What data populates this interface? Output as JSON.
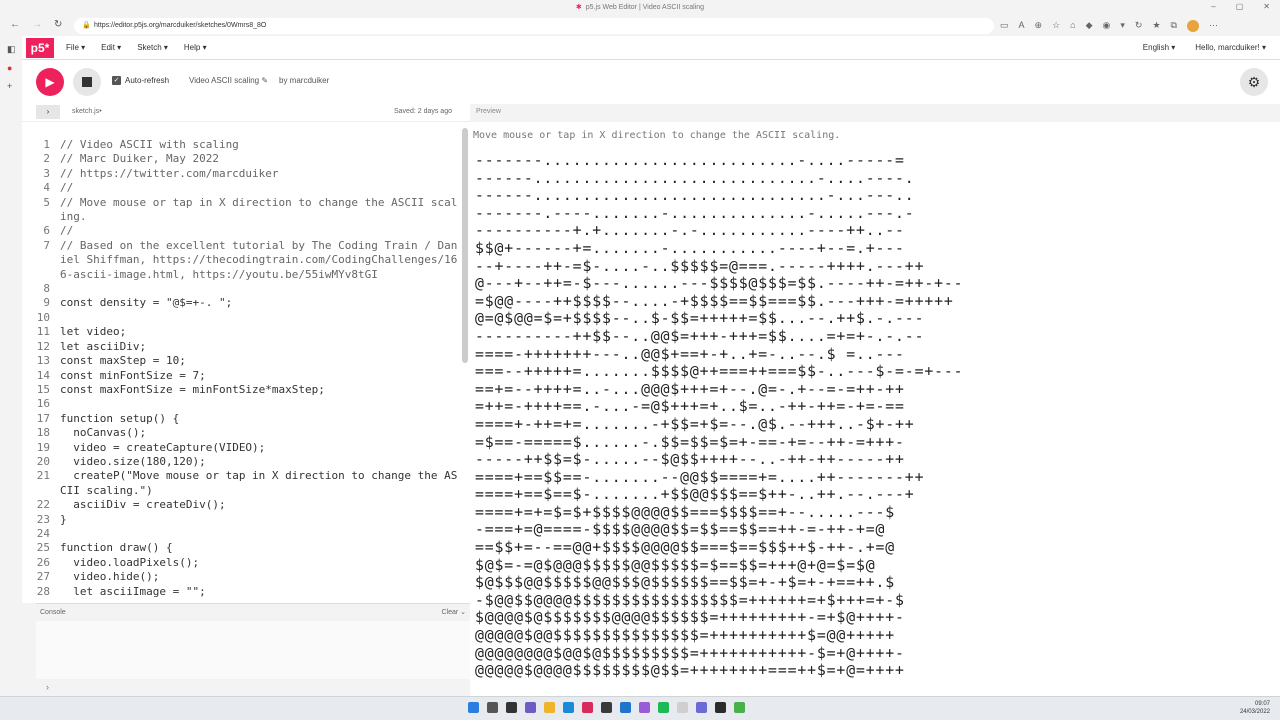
{
  "browser": {
    "window_title": "p5.js Web Editor | Video ASCII scaling",
    "url": "https://editor.p5js.org/marcduiker/sketches/0Wmrs8_8O"
  },
  "p5": {
    "logo": "p5*",
    "menu": [
      "File",
      "Edit",
      "Sketch",
      "Help"
    ],
    "language": "English",
    "greeting": "Hello, marcduiker!",
    "auto_refresh": "Auto-refresh",
    "sketch_name": "Video ASCII scaling",
    "by": "by marcduiker",
    "file_name": "sketch.js",
    "saved": "Saved: 2 days ago",
    "preview_label": "Preview",
    "console_label": "Console",
    "clear_label": "Clear",
    "console_prompt": "›"
  },
  "code": [
    {
      "n": "1",
      "t": "// Video ASCII with scaling",
      "c": "comment"
    },
    {
      "n": "2",
      "t": "// Marc Duiker, May 2022",
      "c": "comment"
    },
    {
      "n": "3",
      "t": "// https://twitter.com/marcduiker",
      "c": "comment"
    },
    {
      "n": "4",
      "t": "//",
      "c": "comment"
    },
    {
      "n": "5",
      "t": "// Move mouse or tap in X direction to change the ASCII scaling.",
      "c": "comment"
    },
    {
      "n": "6",
      "t": "//",
      "c": "comment"
    },
    {
      "n": "7",
      "t": "// Based on the excellent tutorial by The Coding Train / Daniel Shiffman, https://thecodingtrain.com/CodingChallenges/166-ascii-image.html, https://youtu.be/55iwMYv8tGI",
      "c": "comment"
    },
    {
      "n": "8",
      "t": "",
      "c": ""
    },
    {
      "n": "9",
      "t": "const density = \"@$=+-. \";",
      "c": ""
    },
    {
      "n": "10",
      "t": "",
      "c": ""
    },
    {
      "n": "11",
      "t": "let video;",
      "c": ""
    },
    {
      "n": "12",
      "t": "let asciiDiv;",
      "c": ""
    },
    {
      "n": "13",
      "t": "const maxStep = 10;",
      "c": ""
    },
    {
      "n": "14",
      "t": "const minFontSize = 7;",
      "c": ""
    },
    {
      "n": "15",
      "t": "const maxFontSize = minFontSize*maxStep;",
      "c": ""
    },
    {
      "n": "16",
      "t": "",
      "c": ""
    },
    {
      "n": "17",
      "t": "function setup() {",
      "c": ""
    },
    {
      "n": "18",
      "t": "  noCanvas();",
      "c": ""
    },
    {
      "n": "19",
      "t": "  video = createCapture(VIDEO);",
      "c": ""
    },
    {
      "n": "20",
      "t": "  video.size(180,120);",
      "c": ""
    },
    {
      "n": "21",
      "t": "  createP(\"Move mouse or tap in X direction to change the ASCII scaling.\")",
      "c": ""
    },
    {
      "n": "22",
      "t": "  asciiDiv = createDiv();",
      "c": ""
    },
    {
      "n": "23",
      "t": "}",
      "c": ""
    },
    {
      "n": "24",
      "t": "",
      "c": ""
    },
    {
      "n": "25",
      "t": "function draw() {",
      "c": ""
    },
    {
      "n": "26",
      "t": "  video.loadPixels();",
      "c": ""
    },
    {
      "n": "27",
      "t": "  video.hide();",
      "c": ""
    },
    {
      "n": "28",
      "t": "  let asciiImage = \"\";",
      "c": ""
    }
  ],
  "preview": {
    "hint": "Move mouse or tap in X direction to change the ASCII scaling.",
    "ascii": [
      "-------..........................-....-----=",
      "------.............................-....----.",
      "------..............................-...---..",
      "-------.----.......-..............-.....---.-",
      "----------+.+.......-.-...........----++..--",
      "$$@+------+=.......-...........----+--=.+---",
      "--+----++-=$-....-..$$$$$=@===.-----++++.---++",
      "@---+--++=-$---......---$$$$@$$$=$$.----++-=++-+--",
      "=$@@----++$$$$--....-+$$$$==$$===$$.---+++-=+++++",
      "@=@$@@=$=+$$$$--..$-$$=+++++=$$...--.++$.-.---",
      "----------++$$--..@@$=+++-+++=$$....=+=+-.-.--",
      "====-+++++++---..@@$+==+-+..+=-..--.$ =..---",
      "===--+++++=.......$$$$@++===++===$$-..---$-=-=+---",
      "==+=--++++=..-...@@@$+++=+--.@=-.+--=-=++-++",
      "=++=-++++==.-...-=@$+++=+..$=..-++-++=-+=-==",
      "====+-++=+=.......-+$$=+$=--.@$.--+++..-$+-++",
      "=$==-=====$......-.$$=$$=$=+-==-+=--++-=+++-",
      "-----++$$=$-.....--$@$$++++--..-++-++-----++",
      "====+==$$==-.......--@@$$====+=....++-------++",
      "====+==$==$-.......+$$@@$$$==$++-..++.--.---+",
      "====+=+=$=$+$$$$@@@@$$===$$$$==+--.....---$",
      "-===+=@====-$$$$@@@@$$=$$==$$==++-=-++-+=@",
      "==$$+=--==@@+$$$$@@@@$$===$==$$$++$-++-.+=@",
      "$@$=-=@$@@@$$$$$@@$$$$$=$==$$=+++@+@=$=$@",
      "$@$$$@@$$$$$@@$$$@$$$$$$==$$=+-+$=+-+==++.$",
      "-$@@$$@@@@$$$$$$$$$$$$$$$$$=++++++=+$+++=+-$",
      "$@@@@$@$$$$$$$@@@@$$$$$$=+++++++++-=+$@++++-",
      "@@@@@$@@$$$$$$$$$$$$$$$=++++++++++$=@@+++++",
      "@@@@@@@@$@@$@$$$$$$$$$=+++++++++++-$=+@++++-",
      "@@@@@$@@@@$$$$$$$$@$$=++++++++===++$=+@=++++"
    ]
  },
  "taskbar": {
    "time": "09:07",
    "date": "24/03/2022"
  }
}
